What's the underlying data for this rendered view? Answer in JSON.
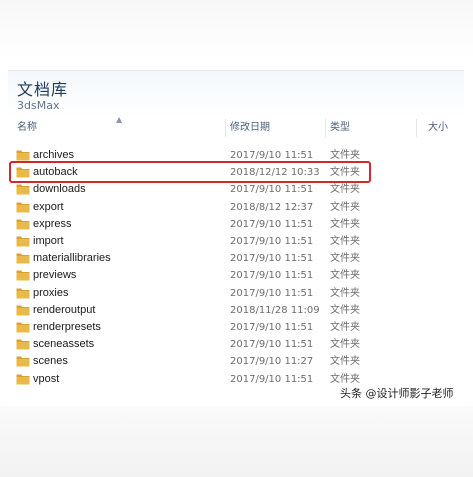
{
  "library": {
    "title": "文档库",
    "subtitle": "3dsMax"
  },
  "columns": {
    "name": "名称",
    "date": "修改日期",
    "type": "类型",
    "size": "大小"
  },
  "folder_color": "#e9b949",
  "highlight_color": "#d12a2a",
  "files": [
    {
      "name": "archives",
      "date": "2017/9/10 11:51",
      "type": "文件夹"
    },
    {
      "name": "autoback",
      "date": "2018/12/12 10:33",
      "type": "文件夹"
    },
    {
      "name": "downloads",
      "date": "2017/9/10 11:51",
      "type": "文件夹"
    },
    {
      "name": "export",
      "date": "2018/8/12 12:37",
      "type": "文件夹"
    },
    {
      "name": "express",
      "date": "2017/9/10 11:51",
      "type": "文件夹"
    },
    {
      "name": "import",
      "date": "2017/9/10 11:51",
      "type": "文件夹"
    },
    {
      "name": "materiallibraries",
      "date": "2017/9/10 11:51",
      "type": "文件夹"
    },
    {
      "name": "previews",
      "date": "2017/9/10 11:51",
      "type": "文件夹"
    },
    {
      "name": "proxies",
      "date": "2017/9/10 11:51",
      "type": "文件夹"
    },
    {
      "name": "renderoutput",
      "date": "2018/11/28 11:09",
      "type": "文件夹"
    },
    {
      "name": "renderpresets",
      "date": "2017/9/10 11:51",
      "type": "文件夹"
    },
    {
      "name": "sceneassets",
      "date": "2017/9/10 11:51",
      "type": "文件夹"
    },
    {
      "name": "scenes",
      "date": "2017/9/10 11:27",
      "type": "文件夹"
    },
    {
      "name": "vpost",
      "date": "2017/9/10 11:51",
      "type": "文件夹"
    }
  ],
  "watermark": "头条 @设计师影子老师"
}
